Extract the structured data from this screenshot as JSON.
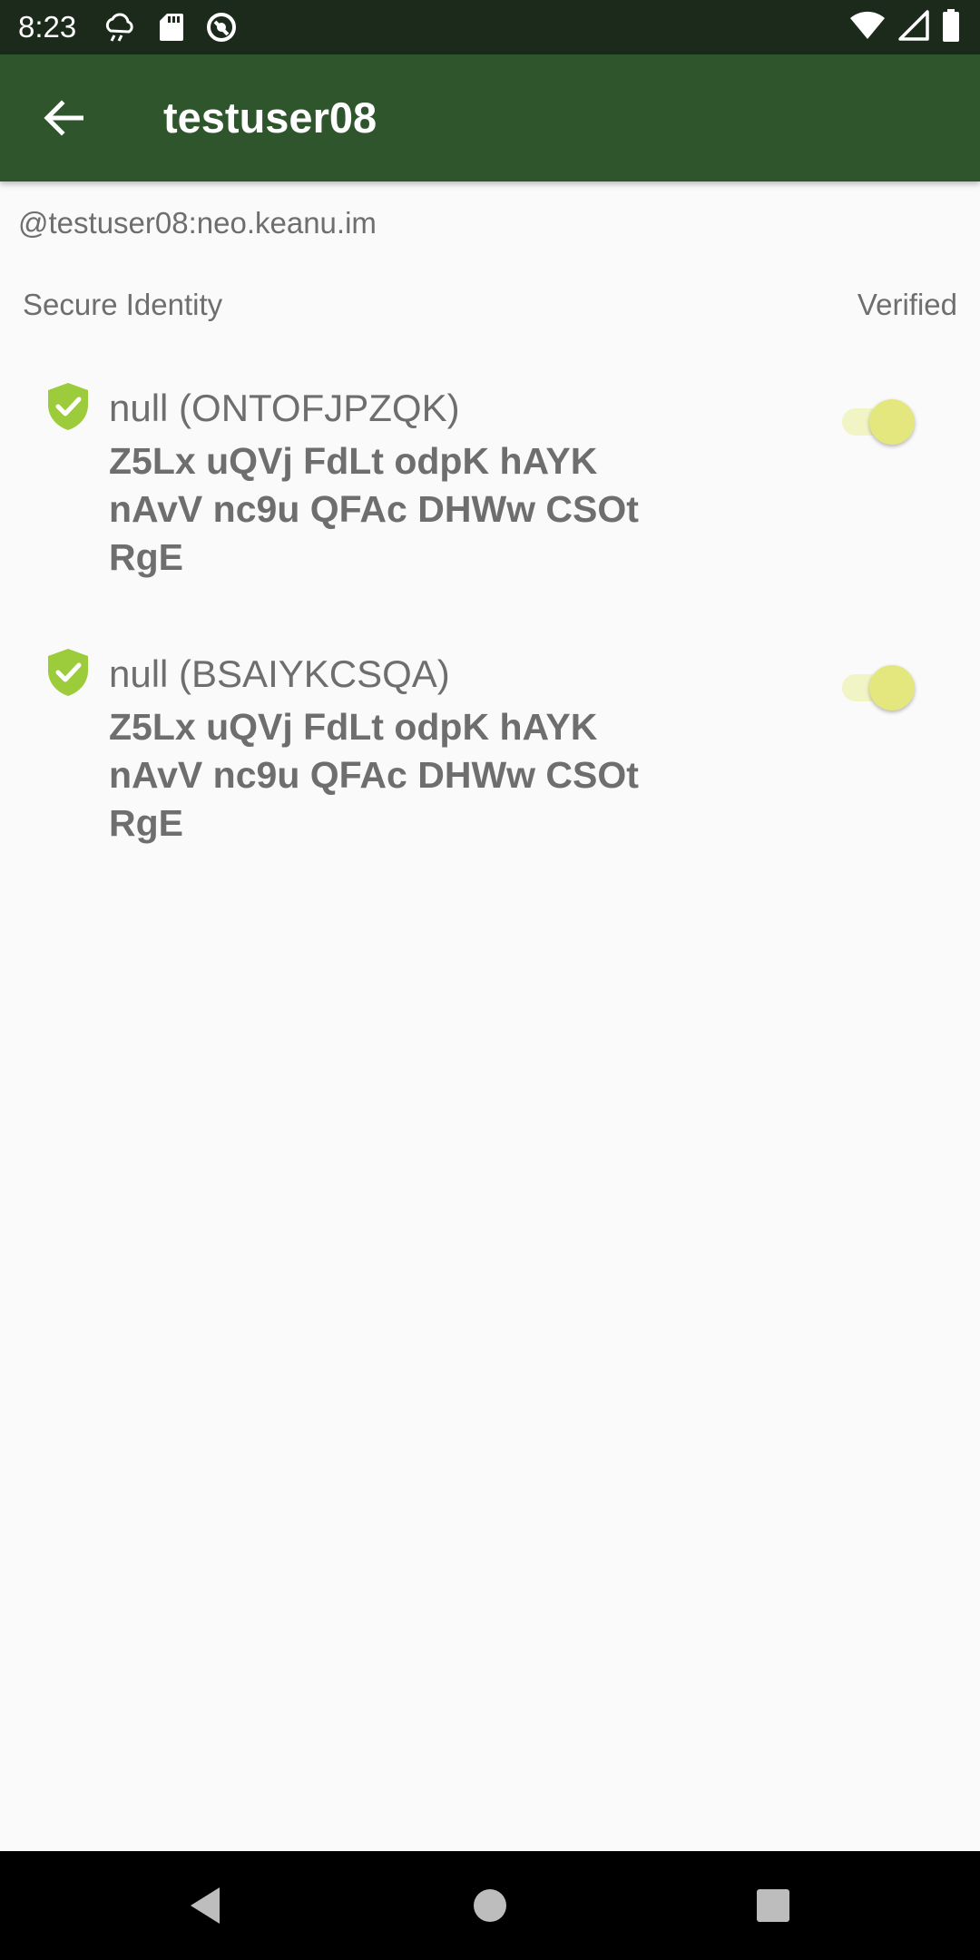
{
  "status_bar": {
    "time": "8:23",
    "left_icons": [
      "weather-icon",
      "sd-card-icon",
      "sync-icon"
    ],
    "right_icons": [
      "wifi-icon",
      "signal-icon",
      "battery-icon"
    ]
  },
  "app_bar": {
    "title": "testuser08",
    "back_icon": "arrow-back-icon",
    "color": "#2e552b"
  },
  "user_id": "@testuser08:neo.keanu.im",
  "section": {
    "left_label": "Secure Identity",
    "right_label": "Verified"
  },
  "devices": [
    {
      "name": "null (ONTOFJPZQK)",
      "key": "Z5Lx uQVj FdLt odpK hAYK nAvV nc9u QFAc DHWw CSOt RgE",
      "verified": true
    },
    {
      "name": "null (BSAIYKCSQA)",
      "key": "Z5Lx uQVj FdLt odpK hAYK nAvV nc9u QFAc DHWw CSOt RgE",
      "verified": true
    }
  ],
  "colors": {
    "shield": "#9ccc3c",
    "toggle_thumb": "#e4e77e",
    "toggle_track": "#f1f4c4",
    "text_secondary": "#6e6e6e"
  },
  "nav_bar": {
    "buttons": [
      "back-triangle-icon",
      "home-circle-icon",
      "recents-square-icon"
    ]
  }
}
